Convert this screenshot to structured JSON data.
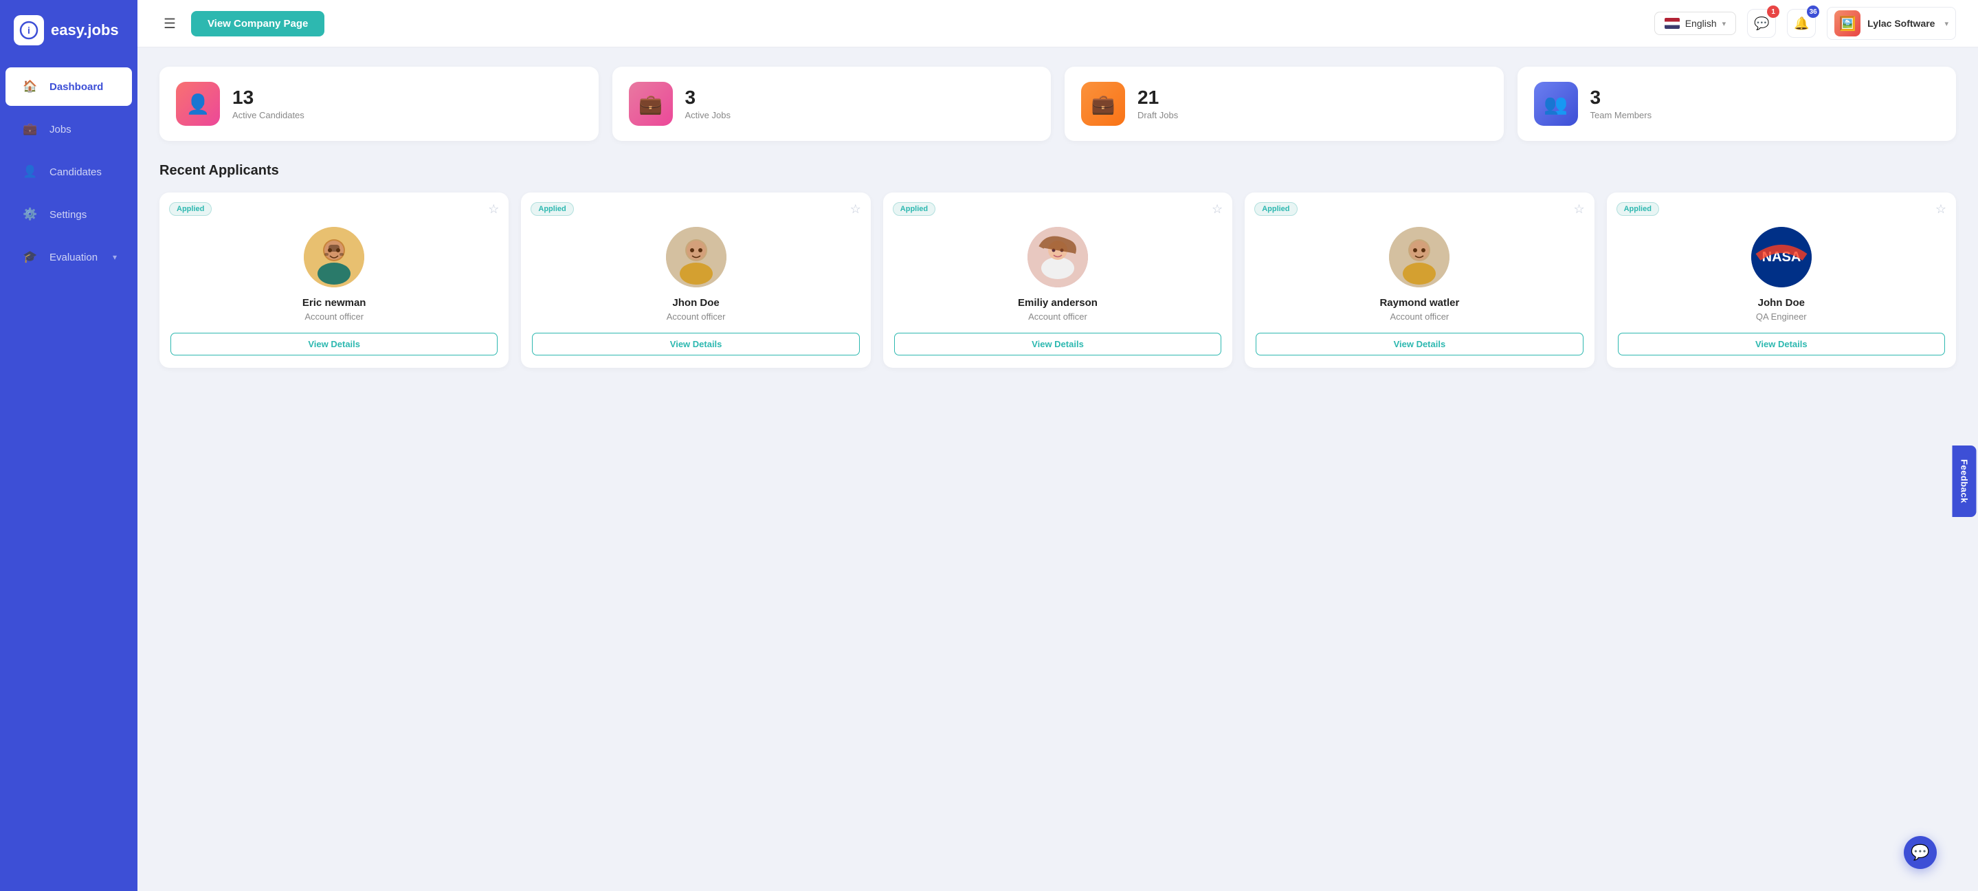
{
  "app": {
    "name": "easy.jobs",
    "logo_symbol": "i"
  },
  "sidebar": {
    "items": [
      {
        "id": "dashboard",
        "label": "Dashboard",
        "icon": "🏠",
        "active": true
      },
      {
        "id": "jobs",
        "label": "Jobs",
        "icon": "💼",
        "active": false
      },
      {
        "id": "candidates",
        "label": "Candidates",
        "icon": "👤",
        "active": false
      },
      {
        "id": "settings",
        "label": "Settings",
        "icon": "⚙️",
        "active": false
      },
      {
        "id": "evaluation",
        "label": "Evaluation",
        "icon": "🎓",
        "active": false,
        "has_chevron": true
      }
    ]
  },
  "header": {
    "view_company_btn": "View Company Page",
    "language": "English",
    "message_badge": "1",
    "notification_badge": "36",
    "user_name": "Lylac Software"
  },
  "stats": [
    {
      "id": "active-candidates",
      "number": "13",
      "label": "Active Candidates",
      "icon_type": "pink",
      "icon": "👤"
    },
    {
      "id": "active-jobs",
      "number": "3",
      "label": "Active Jobs",
      "icon_type": "magenta",
      "icon": "💼"
    },
    {
      "id": "draft-jobs",
      "number": "21",
      "label": "Draft Jobs",
      "icon_type": "orange",
      "icon": "💼"
    },
    {
      "id": "team-members",
      "number": "3",
      "label": "Team Members",
      "icon_type": "blue",
      "icon": "👥"
    }
  ],
  "recent_applicants": {
    "title": "Recent Applicants",
    "cards": [
      {
        "id": "eric",
        "name": "Eric newman",
        "role": "Account officer",
        "badge": "Applied",
        "avatar_class": "avatar-eric",
        "avatar_emoji": "👨"
      },
      {
        "id": "jhon",
        "name": "Jhon Doe",
        "role": "Account officer",
        "badge": "Applied",
        "avatar_class": "avatar-jhon",
        "avatar_emoji": "👨"
      },
      {
        "id": "emily",
        "name": "Emiliy anderson",
        "role": "Account officer",
        "badge": "Applied",
        "avatar_class": "avatar-emily",
        "avatar_emoji": "👩"
      },
      {
        "id": "raymond",
        "name": "Raymond watler",
        "role": "Account officer",
        "badge": "Applied",
        "avatar_class": "avatar-raymond",
        "avatar_emoji": "👨"
      },
      {
        "id": "johndoe2",
        "name": "John Doe",
        "role": "QA Engineer",
        "badge": "Applied",
        "avatar_class": "avatar-nasa",
        "avatar_emoji": "🚀"
      }
    ],
    "view_details_label": "View Details"
  },
  "feedback_btn": "Feedback",
  "chat_icon": "💬"
}
